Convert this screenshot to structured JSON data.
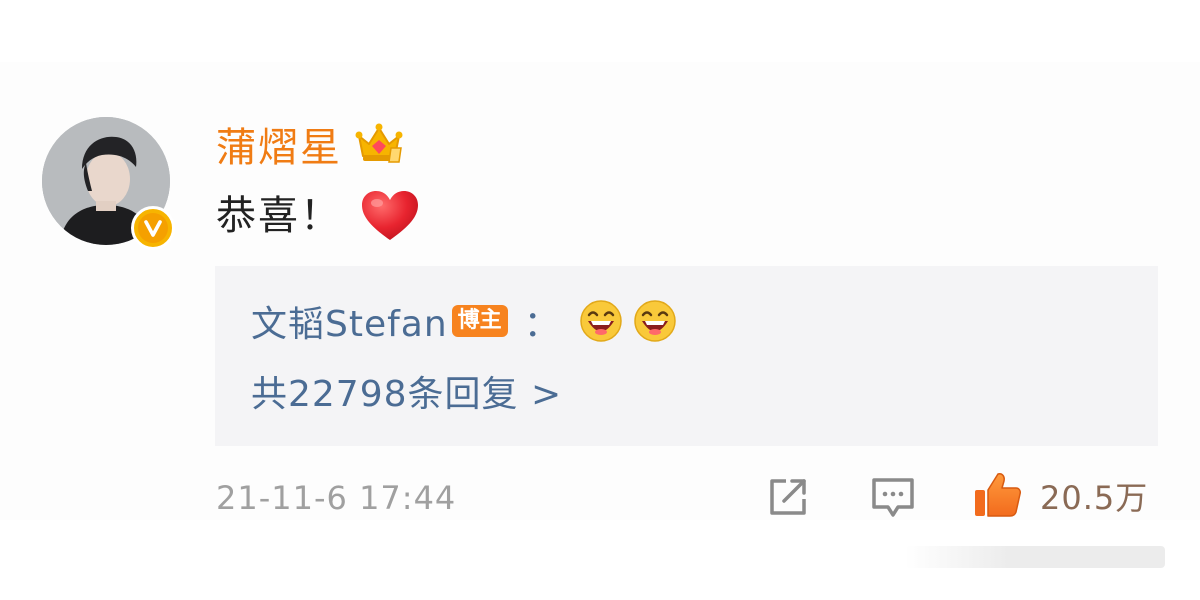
{
  "comment": {
    "username": "蒲熠星",
    "text": "恭喜！",
    "reply_preview": {
      "author": "文韬Stefan",
      "badge": "博主",
      "colon": "："
    },
    "reply_count_label": "共22798条回复 >",
    "timestamp": "21-11-6 17:44",
    "like_count": "20.5万",
    "verified_mark": "V"
  },
  "icons": {
    "crown": "crown-icon",
    "heart": "heart-emoji",
    "laugh": "laughing-emoji",
    "repost": "share-icon",
    "comment": "comment-icon",
    "like": "thumbs-up-icon"
  },
  "colors": {
    "username": "#f07c14",
    "link_blue": "#4b6c94",
    "badge_orange": "#f7831f",
    "verified_gold": "#f7b400",
    "timestamp_gray": "#a0a0a0"
  }
}
